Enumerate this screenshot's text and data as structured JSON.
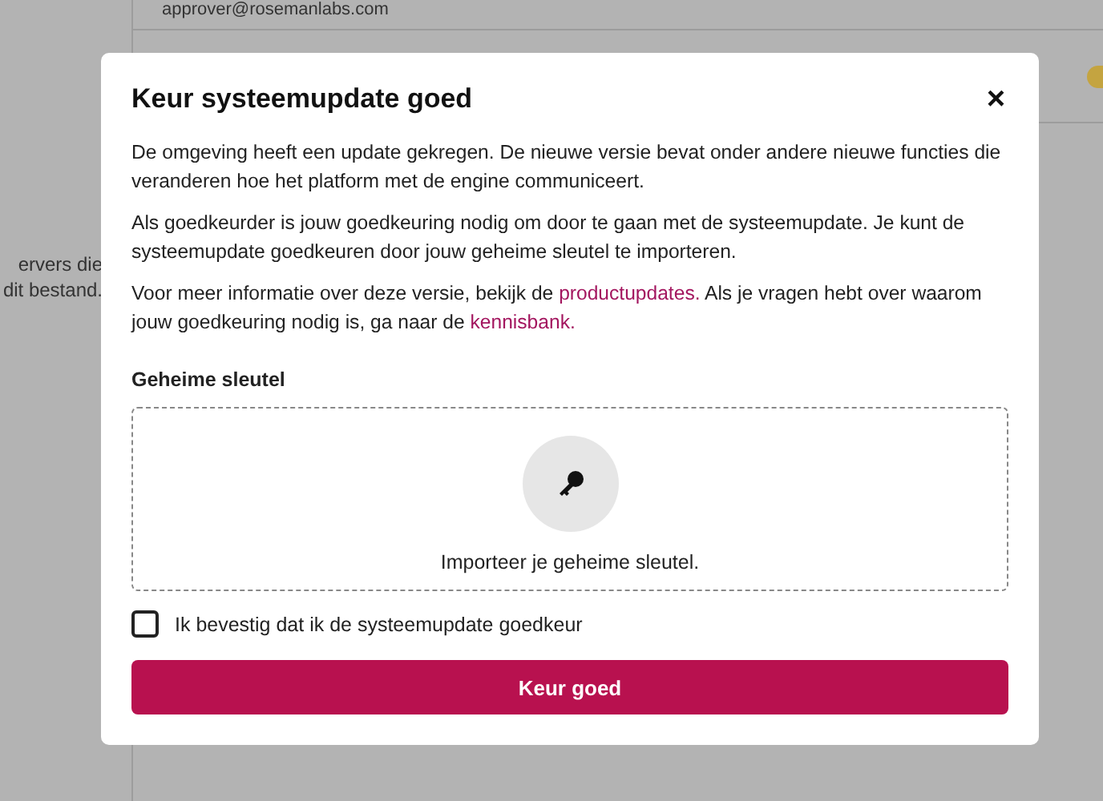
{
  "background": {
    "email": "approver@rosemanlabs.com",
    "snippet_lines": [
      "ervers die",
      "dit bestand."
    ]
  },
  "dialog": {
    "title": "Keur systeemupdate goed",
    "close": "×",
    "paragraphs": [
      [
        {
          "kind": "text",
          "text": "De omgeving heeft een update gekregen. De nieuwe versie bevat onder andere nieuwe functies die veranderen hoe het platform met de engine communiceert."
        }
      ],
      [
        {
          "kind": "text",
          "text": "Als goedkeurder is jouw goedkeuring nodig om door te gaan met de systeemupdate. Je kunt de systeemupdate goedkeuren door jouw geheime sleutel te importeren."
        }
      ],
      [
        {
          "kind": "text",
          "text": "Voor meer informatie over deze versie, bekijk de "
        },
        {
          "kind": "link",
          "text": "productupdates."
        },
        {
          "kind": "text",
          "text": " Als je vragen hebt over waarom jouw goedkeuring nodig is, ga naar de "
        },
        {
          "kind": "link",
          "text": "kennisbank."
        }
      ]
    ],
    "key_label": "Geheime sleutel",
    "dropzone_text": "Importeer je geheime sleutel.",
    "confirm": {
      "label": "Ik bevestig dat ik de systeemupdate goedkeur",
      "checked": false
    },
    "button": "Keur goed"
  }
}
